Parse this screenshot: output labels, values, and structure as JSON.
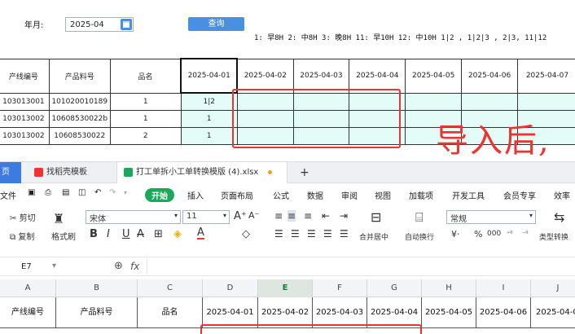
{
  "form": {
    "label": "年月:",
    "value": "2025-04",
    "query": "查询"
  },
  "legend": "1: 早8H  2: 中8H  3: 晚8H   11: 早10H  12: 中10H  1|2 , 1|2|3 , 2|3,   11|12",
  "table": {
    "headers": [
      "产线编号",
      "产品料号",
      "品名",
      "2025-04-01",
      "2025-04-02",
      "2025-04-03",
      "2025-04-04",
      "2025-04-05",
      "2025-04-06",
      "2025-04-07"
    ],
    "rows": [
      [
        "103013001",
        "101020010189",
        "1",
        "1|2"
      ],
      [
        "103013002",
        "10608530022b",
        "1",
        "1"
      ],
      [
        "103013002",
        "10608530022",
        "2",
        "1"
      ]
    ]
  },
  "annotation": "导入后,",
  "tabs": {
    "t1": "页",
    "t2": "找稻壳模板",
    "t3": "打工单拆小工单转换模版 (4).xlsx",
    "plus": "+"
  },
  "menu": {
    "file": "文件",
    "start": "开始",
    "insert": "插入",
    "layout": "页面布局",
    "formula": "公式",
    "data": "数据",
    "review": "审阅",
    "view": "视图",
    "addin": "加载项",
    "dev": "开发工具",
    "member": "会员专享",
    "eff": "效率"
  },
  "toolbar": {
    "cut": "剪切",
    "copy": "复制",
    "painter": "格式刷",
    "font": "宋体",
    "size": "11",
    "merge": "合并居中",
    "wrap": "自动换行",
    "format": "常规",
    "typeconv": "类型转换",
    "percent": "%",
    "thousand": "000"
  },
  "formula": {
    "cell": "E7",
    "fx": "fx"
  },
  "sheet": {
    "cols": [
      "A",
      "B",
      "C",
      "D",
      "E",
      "F",
      "G",
      "H",
      "I",
      "J"
    ],
    "row": [
      "产线编号",
      "产品料号",
      "品名",
      "2025-04-01",
      "2025-04-02",
      "2025-04-03",
      "2025-04-04",
      "2025-04-05",
      "2025-04-06",
      "2025-04-0"
    ]
  }
}
